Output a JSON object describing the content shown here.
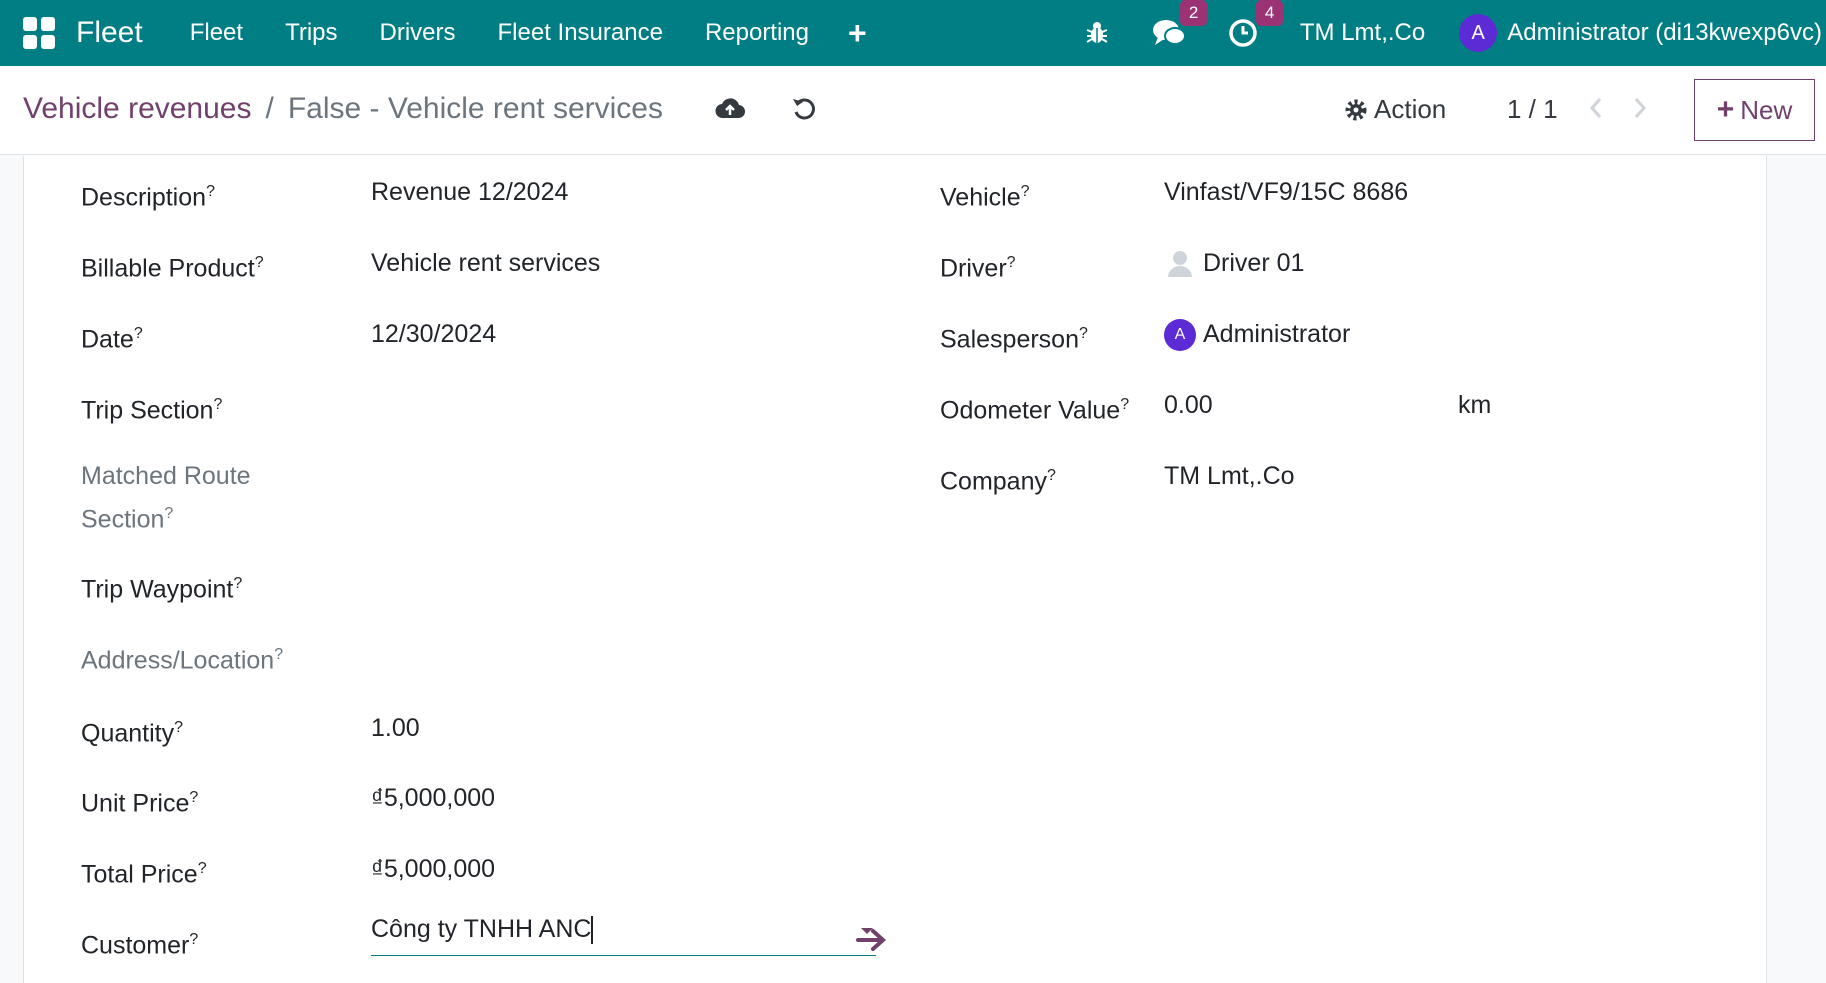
{
  "navbar": {
    "brand": "Fleet",
    "menu": [
      "Fleet",
      "Trips",
      "Drivers",
      "Fleet Insurance",
      "Reporting"
    ],
    "messages_count": "2",
    "activities_count": "4",
    "company": "TM Lmt,.Co",
    "user_initial": "A",
    "user_name": "Administrator (di13kwexp6vc)"
  },
  "control": {
    "breadcrumb_parent": "Vehicle revenues",
    "breadcrumb_separator": "/",
    "breadcrumb_current": "False - Vehicle rent services",
    "action_label": "Action",
    "pager": "1 / 1",
    "new_label": "New"
  },
  "form": {
    "left": {
      "description_label": "Description",
      "description_value": "Revenue 12/2024",
      "billable_label": "Billable Product",
      "billable_value": "Vehicle rent services",
      "date_label": "Date",
      "date_value": "12/30/2024",
      "trip_section_label": "Trip Section",
      "matched_route_label": "Matched Route Section",
      "trip_waypoint_label": "Trip Waypoint",
      "address_label": "Address/Location",
      "quantity_label": "Quantity",
      "quantity_value": "1.00",
      "unit_price_label": "Unit Price",
      "unit_price_value": "₫5,000,000",
      "total_price_label": "Total Price",
      "total_price_value": "₫5,000,000",
      "customer_label": "Customer",
      "customer_value": "Công ty TNHH ANC"
    },
    "right": {
      "vehicle_label": "Vehicle",
      "vehicle_value": "Vinfast/VF9/15C 8686",
      "driver_label": "Driver",
      "driver_value": "Driver 01",
      "salesperson_label": "Salesperson",
      "salesperson_initial": "A",
      "salesperson_value": "Administrator",
      "odometer_label": "Odometer Value",
      "odometer_value": "0.00",
      "odometer_unit": "km",
      "company_label": "Company",
      "company_value": "TM Lmt,.Co"
    },
    "help_mark": "?"
  },
  "colors": {
    "navbar": "#017e84",
    "primary": "#71406c",
    "badge": "#9a3274",
    "avatar": "#5c2bd6"
  }
}
